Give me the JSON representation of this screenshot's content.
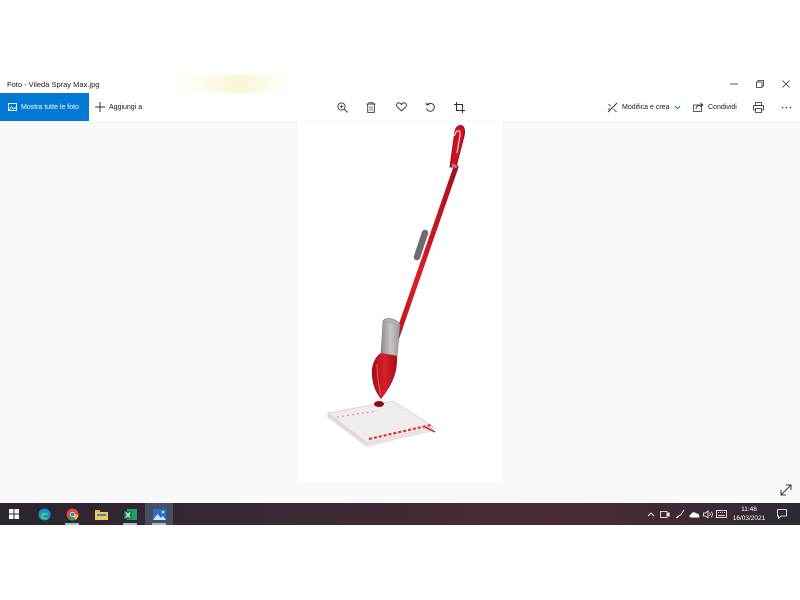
{
  "window": {
    "title": "Foto - Vileda Spray Max.jpg"
  },
  "toolbar": {
    "show_all_label": "Mostra tutte le foto",
    "add_to_label": "Aggiungi a",
    "edit_create_label": "Modifica e crea",
    "share_label": "Condividi"
  },
  "taskbar": {
    "time": "11:48",
    "date": "16/03/2021"
  },
  "colors": {
    "accent": "#0078d4",
    "mop_red": "#c8141e",
    "taskbar": "#2b2530"
  }
}
